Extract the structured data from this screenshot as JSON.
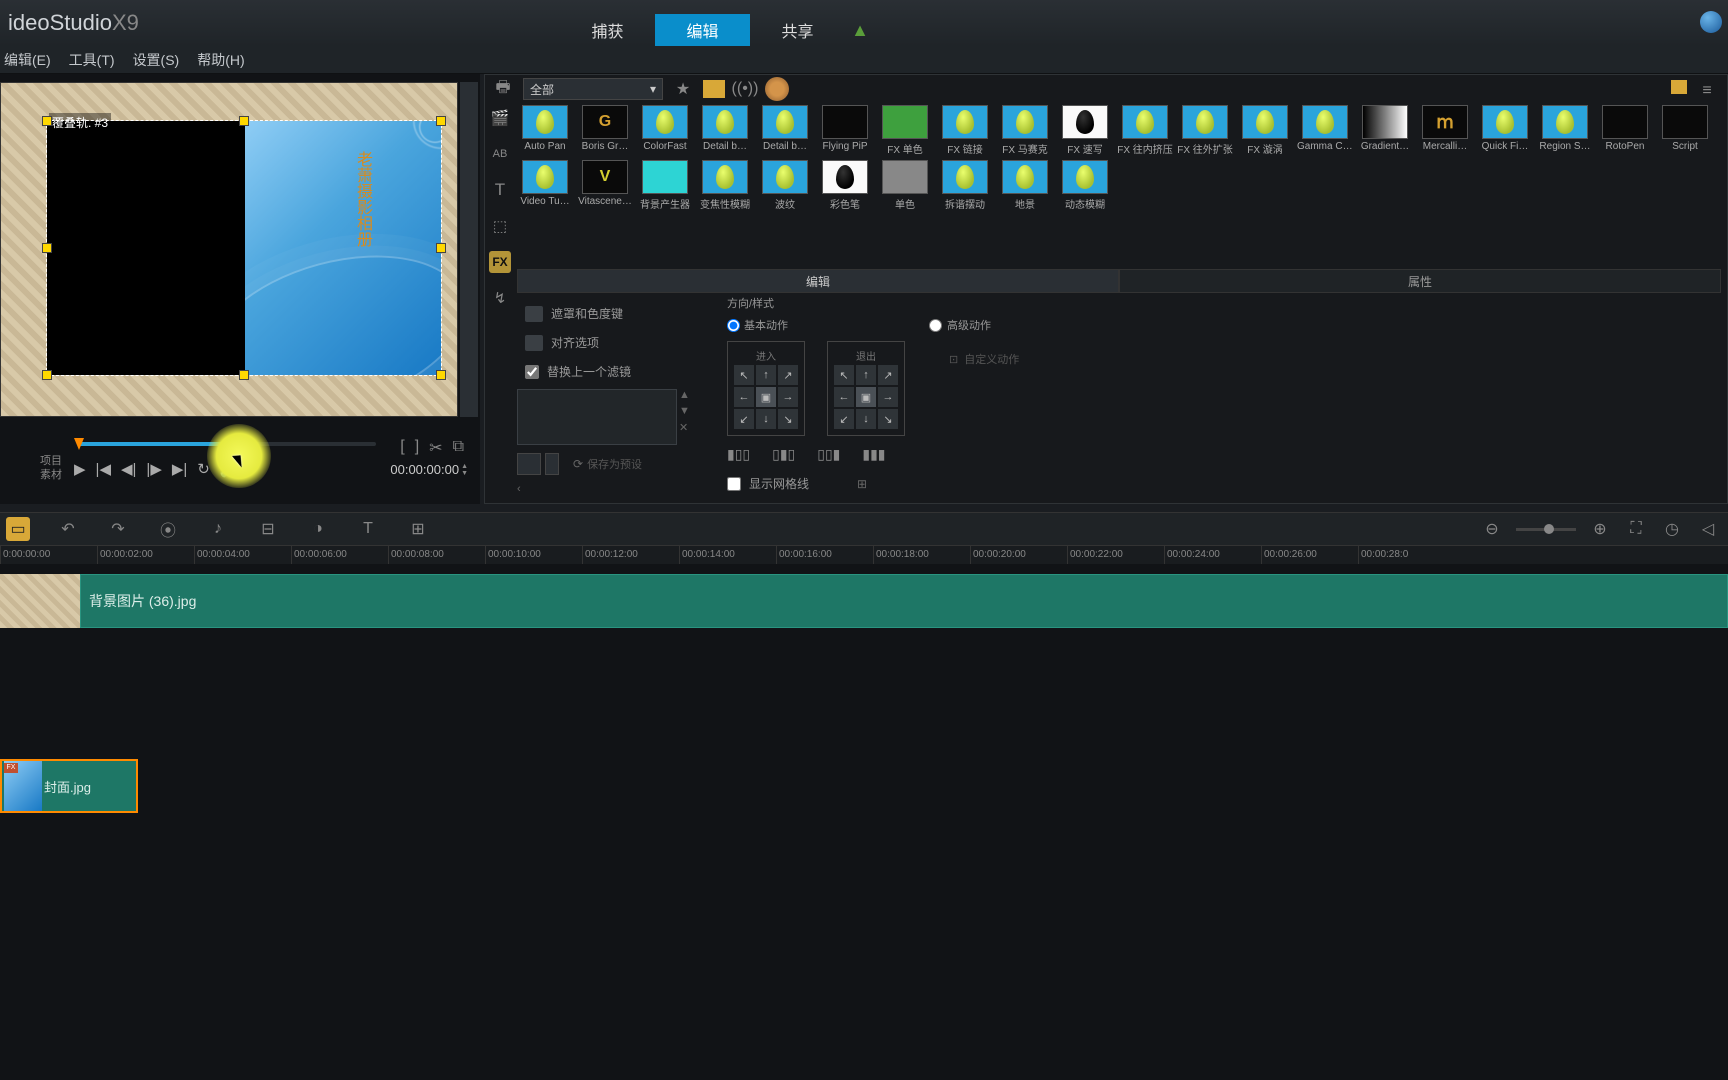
{
  "app": {
    "title_prefix": "ideoStudio",
    "title_suffix": "X9"
  },
  "tabs": {
    "capture": "捕获",
    "edit": "编辑",
    "share": "共享"
  },
  "menu": {
    "edit": "编辑(E)",
    "tools": "工具(T)",
    "settings": "设置(S)",
    "help": "帮助(H)"
  },
  "preview": {
    "track_label": "覆叠轨. #3",
    "vertical_text": "老萧摄影相册",
    "mode_project": "项目",
    "mode_clip": "素材",
    "timecode": "00:00:00:00"
  },
  "library": {
    "dropdown": "全部",
    "effects_row1": [
      {
        "label": "Auto Pan",
        "cls": ""
      },
      {
        "label": "Boris Gr…",
        "cls": "black"
      },
      {
        "label": "ColorFast",
        "cls": ""
      },
      {
        "label": "Detail b…",
        "cls": ""
      },
      {
        "label": "Detail b…",
        "cls": ""
      },
      {
        "label": "Flying PiP",
        "cls": "black"
      },
      {
        "label": "FX 单色",
        "cls": "green"
      },
      {
        "label": "FX 链接",
        "cls": ""
      },
      {
        "label": "FX 马赛克",
        "cls": ""
      },
      {
        "label": "FX 速写",
        "cls": "white"
      },
      {
        "label": "FX 往内挤压",
        "cls": ""
      },
      {
        "label": "FX 往外扩张",
        "cls": ""
      },
      {
        "label": "FX 漩涡",
        "cls": ""
      },
      {
        "label": "Gamma Co…",
        "cls": ""
      },
      {
        "label": "Gradient…",
        "cls": "grad"
      }
    ],
    "effects_row2": [
      {
        "label": "Mercalli…",
        "cls": "black"
      },
      {
        "label": "Quick Fi…",
        "cls": ""
      },
      {
        "label": "Region S…",
        "cls": ""
      },
      {
        "label": "RotoPen",
        "cls": "black"
      },
      {
        "label": "Script",
        "cls": "black"
      },
      {
        "label": "Video Tu…",
        "cls": ""
      },
      {
        "label": "Vitascene…",
        "cls": "black"
      },
      {
        "label": "背景产生器",
        "cls": "cyan"
      },
      {
        "label": "变焦性模糊",
        "cls": ""
      },
      {
        "label": "波纹",
        "cls": ""
      },
      {
        "label": "彩色笔",
        "cls": "white"
      },
      {
        "label": "单色",
        "cls": "gray"
      },
      {
        "label": "拆谐摆动",
        "cls": ""
      },
      {
        "label": "地景",
        "cls": ""
      },
      {
        "label": "动态模糊",
        "cls": ""
      }
    ],
    "prop_tabs": {
      "edit": "编辑",
      "attr": "属性"
    },
    "checks": {
      "mask": "遮罩和色度键",
      "align": "对齐选项",
      "replace": "替换上一个滤镜",
      "grid": "显示网格线",
      "save_dlg": "保存为预设"
    },
    "direction": {
      "title": "方向/样式",
      "basic": "基本动作",
      "advanced": "高级动作",
      "enter": "进入",
      "exit": "退出"
    }
  },
  "ruler": [
    "0:00:00:00",
    "00:00:02:00",
    "00:00:04:00",
    "00:00:06:00",
    "00:00:08:00",
    "00:00:10:00",
    "00:00:12:00",
    "00:00:14:00",
    "00:00:16:00",
    "00:00:18:00",
    "00:00:20:00",
    "00:00:22:00",
    "00:00:24:00",
    "00:00:26:00",
    "00:00:28:0"
  ],
  "clips": {
    "bg": "背景图片 (36).jpg",
    "cover": "封面.jpg"
  }
}
